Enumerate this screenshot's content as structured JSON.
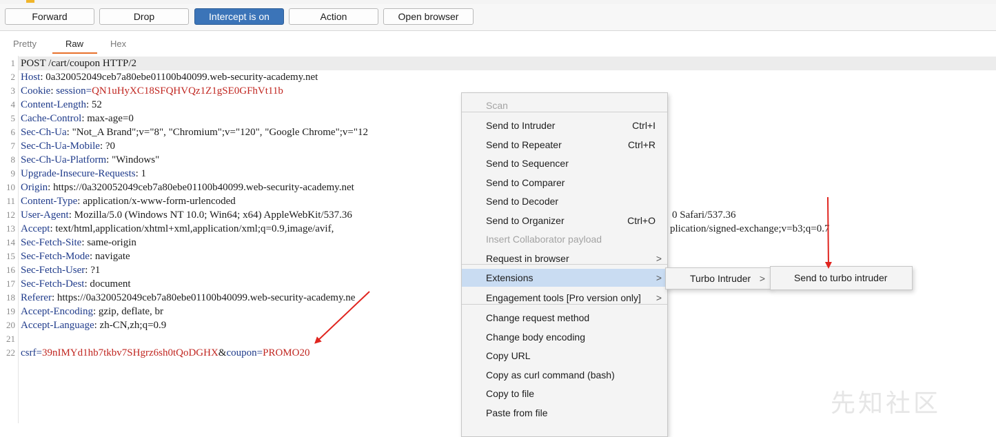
{
  "toolbar": {
    "forward": "Forward",
    "drop": "Drop",
    "intercept": "Intercept is on",
    "action": "Action",
    "open_browser": "Open browser",
    "accent_color": "#3b74b8"
  },
  "tabs": {
    "pretty": "Pretty",
    "raw": "Raw",
    "hex": "Hex",
    "selected": "Raw"
  },
  "request": {
    "lines": [
      {
        "n": "1",
        "name": "",
        "sep": "",
        "value": "POST /cart/coupon HTTP/2"
      },
      {
        "n": "2",
        "name": "Host",
        "sep": ": ",
        "value": "0a320052049ceb7a80ebe01100b40099.web-security-academy.net"
      },
      {
        "n": "3",
        "name": "Cookie",
        "sep": ": ",
        "value": "session=QN1uHyXC18SFQHVQz1Z1gSE0GFhVt11b"
      },
      {
        "n": "4",
        "name": "Content-Length",
        "sep": ": ",
        "value": "52"
      },
      {
        "n": "5",
        "name": "Cache-Control",
        "sep": ": ",
        "value": "max-age=0"
      },
      {
        "n": "6",
        "name": "Sec-Ch-Ua",
        "sep": ": ",
        "value": "\"Not_A Brand\";v=\"8\", \"Chromium\";v=\"120\", \"Google Chrome\";v=\"12"
      },
      {
        "n": "7",
        "name": "Sec-Ch-Ua-Mobile",
        "sep": ": ",
        "value": "?0"
      },
      {
        "n": "8",
        "name": "Sec-Ch-Ua-Platform",
        "sep": ": ",
        "value": "\"Windows\""
      },
      {
        "n": "9",
        "name": "Upgrade-Insecure-Requests",
        "sep": ": ",
        "value": "1"
      },
      {
        "n": "10",
        "name": "Origin",
        "sep": ": ",
        "value": "https://0a320052049ceb7a80ebe01100b40099.web-security-academy.net"
      },
      {
        "n": "11",
        "name": "Content-Type",
        "sep": ": ",
        "value": "application/x-www-form-urlencoded"
      },
      {
        "n": "12",
        "name": "User-Agent",
        "sep": ": ",
        "value": "Mozilla/5.0 (Windows NT 10.0; Win64; x64) AppleWebKit/537.36"
      },
      {
        "n": "13",
        "name": "Accept",
        "sep": ": ",
        "value": "text/html,application/xhtml+xml,application/xml;q=0.9,image/avif,"
      },
      {
        "n": "14",
        "name": "Sec-Fetch-Site",
        "sep": ": ",
        "value": "same-origin"
      },
      {
        "n": "15",
        "name": "Sec-Fetch-Mode",
        "sep": ": ",
        "value": "navigate"
      },
      {
        "n": "16",
        "name": "Sec-Fetch-User",
        "sep": ": ",
        "value": "?1"
      },
      {
        "n": "17",
        "name": "Sec-Fetch-Dest",
        "sep": ": ",
        "value": "document"
      },
      {
        "n": "18",
        "name": "Referer",
        "sep": ": ",
        "value": "https://0a320052049ceb7a80ebe01100b40099.web-security-academy.ne"
      },
      {
        "n": "19",
        "name": "Accept-Encoding",
        "sep": ": ",
        "value": "gzip, deflate, br"
      },
      {
        "n": "20",
        "name": "Accept-Language",
        "sep": ": ",
        "value": "zh-CN,zh;q=0.9"
      },
      {
        "n": "21",
        "name": "",
        "sep": "",
        "value": ""
      },
      {
        "n": "22",
        "name": "",
        "sep": "",
        "value": ""
      }
    ],
    "cookie_key": "session=",
    "cookie_val": "QN1uHyXC18SFQHVQz1Z1gSE0GFhVt11b",
    "body": {
      "k1": "csrf",
      "v1": "39nIMYd1hb7tkbv7SHgrz6sh0tQoDGHX",
      "amp": "&",
      "k2": "coupon",
      "v2": "PROMO20",
      "eq": "="
    },
    "tail12": "0 Safari/537.36",
    "tail13": "plication/signed-exchange;v=b3;q=0.7"
  },
  "context_menu": {
    "items": [
      {
        "label": "Scan",
        "shortcut": "",
        "disabled": true,
        "submenu": false
      },
      {
        "label": "Send to Intruder",
        "shortcut": "Ctrl+I",
        "disabled": false,
        "submenu": false
      },
      {
        "label": "Send to Repeater",
        "shortcut": "Ctrl+R",
        "disabled": false,
        "submenu": false
      },
      {
        "label": "Send to Sequencer",
        "shortcut": "",
        "disabled": false,
        "submenu": false
      },
      {
        "label": "Send to Comparer",
        "shortcut": "",
        "disabled": false,
        "submenu": false
      },
      {
        "label": "Send to Decoder",
        "shortcut": "",
        "disabled": false,
        "submenu": false
      },
      {
        "label": "Send to Organizer",
        "shortcut": "Ctrl+O",
        "disabled": false,
        "submenu": false
      },
      {
        "label": "Insert Collaborator payload",
        "shortcut": "",
        "disabled": true,
        "submenu": false
      },
      {
        "label": "Request in browser",
        "shortcut": "",
        "disabled": false,
        "submenu": true
      },
      {
        "label": "Extensions",
        "shortcut": "",
        "disabled": false,
        "submenu": true
      },
      {
        "label": "Engagement tools [Pro version only]",
        "shortcut": "",
        "disabled": false,
        "submenu": true
      },
      {
        "label": "Change request method",
        "shortcut": "",
        "disabled": false,
        "submenu": false
      },
      {
        "label": "Change body encoding",
        "shortcut": "",
        "disabled": false,
        "submenu": false
      },
      {
        "label": "Copy URL",
        "shortcut": "",
        "disabled": false,
        "submenu": false
      },
      {
        "label": "Copy as curl command (bash)",
        "shortcut": "",
        "disabled": false,
        "submenu": false
      },
      {
        "label": "Copy to file",
        "shortcut": "",
        "disabled": false,
        "submenu": false
      },
      {
        "label": "Paste from file",
        "shortcut": "",
        "disabled": false,
        "submenu": false
      }
    ],
    "highlighted": "Extensions",
    "highlight_color": "#c9dcf2"
  },
  "submenu1": {
    "label": "Turbo Intruder"
  },
  "submenu2": {
    "label": "Send to turbo intruder"
  },
  "watermark": "先知社区",
  "annotation_color": "#e0251f"
}
